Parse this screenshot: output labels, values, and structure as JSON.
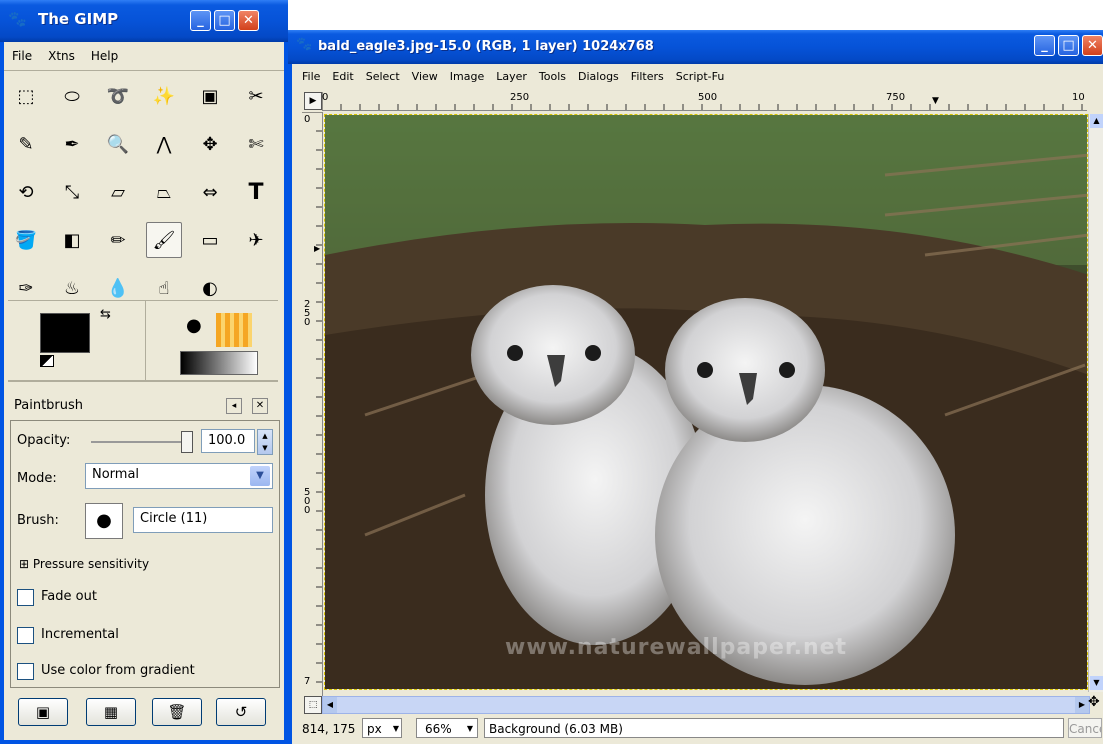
{
  "toolbox": {
    "title": "The GIMP",
    "menu": [
      "File",
      "Xtns",
      "Help"
    ],
    "tools": [
      "rect-select-icon",
      "ellipse-select-icon",
      "lasso-icon",
      "magic-wand-icon",
      "color-select-icon",
      "scissors-icon",
      "paths-icon",
      "color-picker-icon",
      "zoom-icon",
      "measure-icon",
      "move-icon",
      "crop-icon",
      "rotate-icon",
      "scale-icon",
      "shear-icon",
      "perspective-icon",
      "flip-icon",
      "text-icon",
      "bucket-fill-icon",
      "blend-icon",
      "pencil-icon",
      "paintbrush-icon",
      "eraser-icon",
      "airbrush-icon",
      "ink-icon",
      "clone-icon",
      "blur-icon",
      "smudge-icon",
      "dodge-burn-icon"
    ],
    "active_tool": "paintbrush-icon",
    "fg_color": "#000000",
    "bg_color": "#ffffff"
  },
  "tool_options": {
    "title": "Paintbrush",
    "opacity_label": "Opacity:",
    "opacity_value": "100.0",
    "opacity_fraction": 1.0,
    "mode_label": "Mode:",
    "mode_value": "Normal",
    "brush_label": "Brush:",
    "brush_name": "Circle (11)",
    "pressure_label": "Pressure sensitivity",
    "fade_label": "Fade out",
    "incremental_label": "Incremental",
    "gradient_label": "Use color from gradient",
    "bottom_buttons": [
      "save-options-icon",
      "restore-options-icon",
      "delete-options-icon",
      "reset-options-icon"
    ]
  },
  "image_window": {
    "title": "bald_eagle3.jpg-15.0 (RGB, 1 layer) 1024x768",
    "menu": [
      "File",
      "Edit",
      "Select",
      "View",
      "Image",
      "Layer",
      "Tools",
      "Dialogs",
      "Filters",
      "Script-Fu"
    ],
    "ruler_h_labels": [
      "0",
      "250",
      "500",
      "750",
      "10"
    ],
    "ruler_v_labels": [
      "0",
      "250",
      "500",
      "7"
    ],
    "watermark": "www.naturewallpaper.net",
    "status": {
      "coords": "814, 175",
      "unit": "px",
      "zoom": "66%",
      "info": "Background (6.03 MB)",
      "cancel": "Cance"
    }
  },
  "colors": {
    "xp_blue": "#0054e3",
    "window_bg": "#ece9d8",
    "close_red": "#d2401b"
  }
}
